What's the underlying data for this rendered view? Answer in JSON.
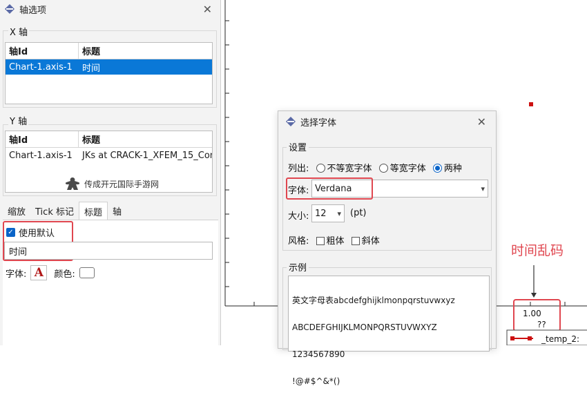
{
  "axis_panel": {
    "title": "轴选项",
    "x_group": "X 轴",
    "y_group": "Y 轴",
    "col_id": "轴Id",
    "col_title": "标题",
    "x_row": {
      "id": "Chart-1.axis-1",
      "title": "时间"
    },
    "y_row": {
      "id": "Chart-1.axis-1",
      "title": "JKs at CRACK-1_XFEM_15_Con"
    },
    "watermark": "传成开元国际手游网",
    "tabs": [
      "缩放",
      "Tick 标记",
      "标题",
      "轴"
    ],
    "use_default": "使用默认",
    "title_value": "时间",
    "font_label": "字体:",
    "color_label": "颜色:"
  },
  "font_dialog": {
    "title": "选择字体",
    "settings_group": "设置",
    "list_label": "列出:",
    "opt_proportional": "不等宽字体",
    "opt_mono": "等宽字体",
    "opt_both": "两种",
    "font_label": "字体:",
    "font_value": "Verdana",
    "size_label": "大小:",
    "size_value": "12",
    "size_unit": "(pt)",
    "style_label": "风格:",
    "bold": "粗体",
    "italic": "斜体",
    "sample_group": "示例",
    "sample_lines": [
      "英文字母表abcdefghijklmonpqrstuvwxyz",
      "ABCDEFGHIJKLMONPQRSTUVWXYZ",
      "1234567890",
      "!@#$^&*()"
    ]
  },
  "chart": {
    "tick_value": "1.00",
    "garbled_title": "??",
    "legend_text": "_temp_2:",
    "annotation": "时间乱码",
    "accent_red": "#e0464f",
    "marker_red": "#cc1111"
  }
}
